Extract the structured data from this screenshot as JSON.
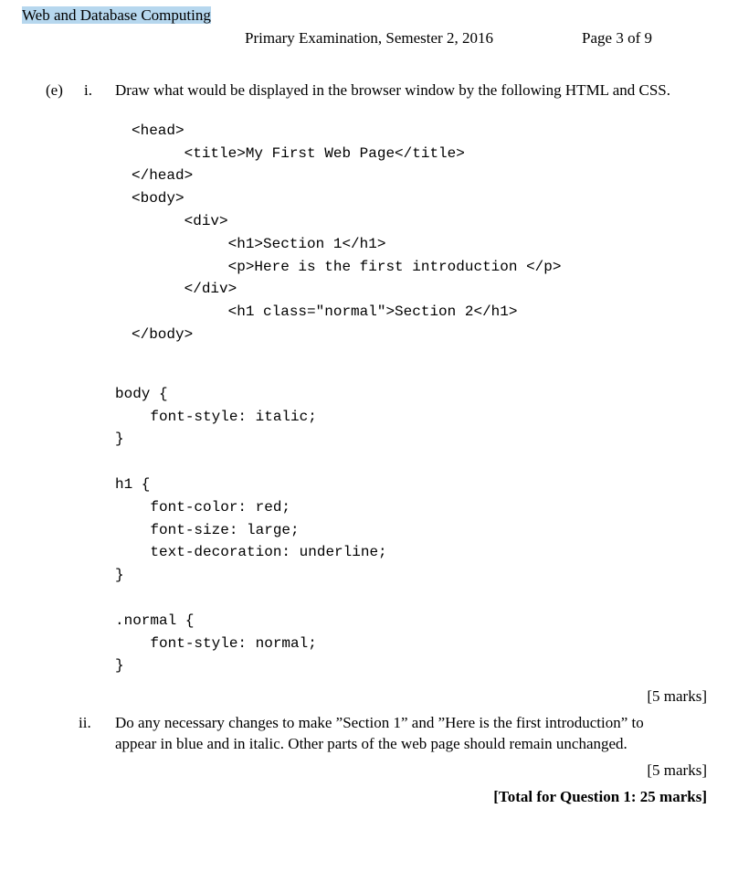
{
  "header": {
    "course": "Web and Database Computing",
    "exam_line": "Primary Examination, Semester 2, 2016",
    "page_label": "Page 3 of 9"
  },
  "question": {
    "label": "(e)",
    "parts": {
      "i": {
        "label": "i.",
        "prompt": "Draw what would be displayed in the browser window by the following HTML and CSS.",
        "code_html": "<head>\n      <title>My First Web Page</title>\n</head>\n<body>\n      <div>\n           <h1>Section 1</h1>\n           <p>Here is the first introduction </p>\n      </div>\n           <h1 class=\"normal\">Section 2</h1>\n</body>",
        "code_css": "body {\n    font-style: italic;\n}\n\nh1 {\n    font-color: red;\n    font-size: large;\n    text-decoration: underline;\n}\n\n.normal {\n    font-style: normal;\n}",
        "marks": "[5 marks]"
      },
      "ii": {
        "label": "ii.",
        "prompt": "Do any necessary changes to make ”Section 1” and ”Here is the first introduction” to appear in blue and in italic. Other parts of the web page should remain unchanged.",
        "marks": "[5 marks]"
      }
    },
    "total": "[Total for Question 1: 25 marks]"
  }
}
